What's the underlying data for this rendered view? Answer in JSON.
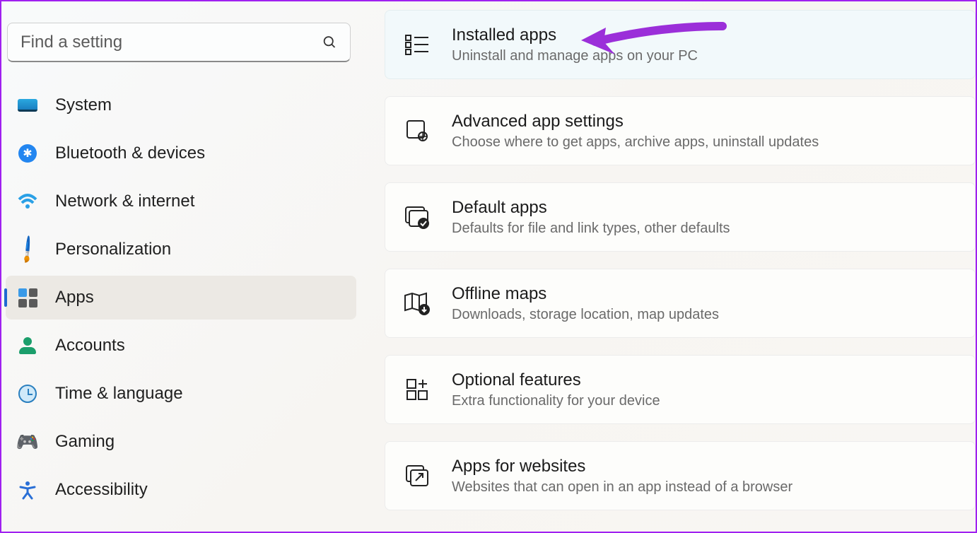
{
  "search": {
    "placeholder": "Find a setting"
  },
  "sidebar": {
    "items": [
      {
        "label": "System",
        "icon": "system-icon"
      },
      {
        "label": "Bluetooth & devices",
        "icon": "bluetooth-icon"
      },
      {
        "label": "Network & internet",
        "icon": "wifi-icon"
      },
      {
        "label": "Personalization",
        "icon": "paintbrush-icon"
      },
      {
        "label": "Apps",
        "icon": "apps-grid-icon",
        "selected": true
      },
      {
        "label": "Accounts",
        "icon": "person-icon"
      },
      {
        "label": "Time & language",
        "icon": "clock-globe-icon"
      },
      {
        "label": "Gaming",
        "icon": "gamepad-icon"
      },
      {
        "label": "Accessibility",
        "icon": "accessibility-icon"
      }
    ]
  },
  "main": {
    "cards": [
      {
        "title": "Installed apps",
        "subtitle": "Uninstall and manage apps on your PC",
        "icon": "list-grid-icon",
        "highlighted": true
      },
      {
        "title": "Advanced app settings",
        "subtitle": "Choose where to get apps, archive apps, uninstall updates",
        "icon": "app-gear-icon"
      },
      {
        "title": "Default apps",
        "subtitle": "Defaults for file and link types, other defaults",
        "icon": "window-check-icon"
      },
      {
        "title": "Offline maps",
        "subtitle": "Downloads, storage location, map updates",
        "icon": "map-download-icon"
      },
      {
        "title": "Optional features",
        "subtitle": "Extra functionality for your device",
        "icon": "grid-plus-icon"
      },
      {
        "title": "Apps for websites",
        "subtitle": "Websites that can open in an app instead of a browser",
        "icon": "window-arrow-icon"
      }
    ]
  },
  "annotation": {
    "type": "arrow",
    "color": "#9b2fd9",
    "points_to": "Installed apps"
  }
}
